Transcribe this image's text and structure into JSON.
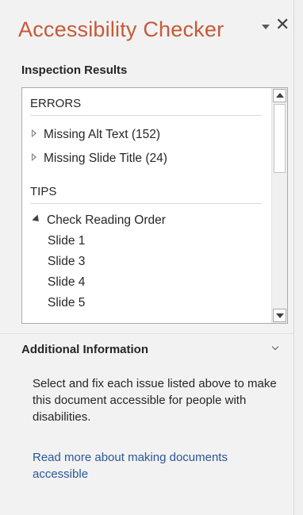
{
  "pane": {
    "title": "Accessibility Checker",
    "controls": {
      "pin_icon": "triangle-down-icon",
      "close_icon": "close-icon",
      "close_glyph": "✕"
    }
  },
  "inspection": {
    "label": "Inspection Results",
    "groups": [
      {
        "header": "ERRORS",
        "items": [
          {
            "label": "Missing Alt Text (152)",
            "state": "collapsed"
          },
          {
            "label": "Missing Slide Title (24)",
            "state": "collapsed"
          }
        ]
      },
      {
        "header": "TIPS",
        "items": [
          {
            "label": "Check Reading Order",
            "state": "expanded",
            "children": [
              "Slide 1",
              "Slide 3",
              "Slide 4",
              "Slide 5"
            ]
          }
        ]
      }
    ]
  },
  "additional": {
    "title": "Additional Information",
    "description": "Select and fix each issue listed above to make this document accessible for people with disabilities.",
    "link": "Read more about making documents accessible"
  },
  "colors": {
    "title": "#c55a3a",
    "link": "#2b579a",
    "background": "#f2f2f2"
  }
}
